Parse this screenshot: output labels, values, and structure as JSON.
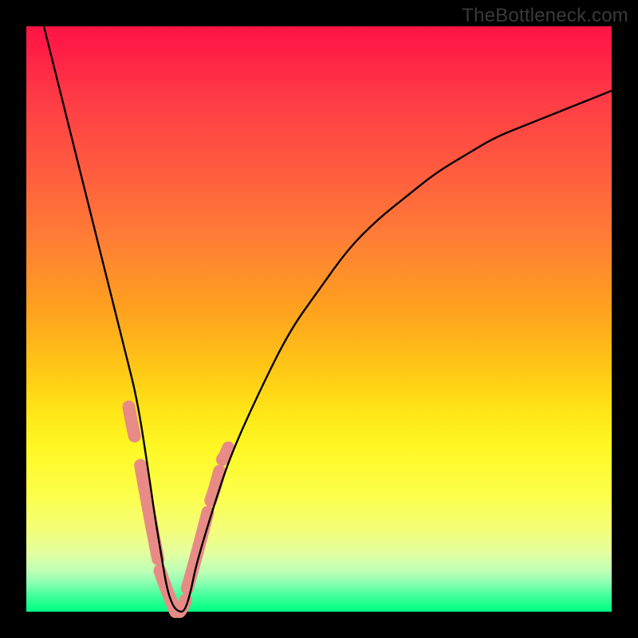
{
  "watermark": "TheBottleneck.com",
  "chart_data": {
    "type": "line",
    "title": "",
    "xlabel": "",
    "ylabel": "",
    "xlim": [
      0,
      100
    ],
    "ylim": [
      0,
      100
    ],
    "grid": false,
    "series": [
      {
        "name": "curve",
        "color": "#000000",
        "x": [
          3,
          5,
          7,
          9,
          11,
          13,
          15,
          17,
          19,
          21,
          22,
          23,
          24,
          25,
          26,
          27,
          28,
          29,
          32,
          35,
          40,
          45,
          50,
          55,
          60,
          65,
          70,
          75,
          80,
          85,
          90,
          95,
          100
        ],
        "y": [
          100,
          92,
          84,
          76,
          68,
          60,
          52,
          44,
          36,
          23,
          16,
          10,
          4,
          1,
          0,
          0,
          3,
          8,
          18,
          27,
          38,
          48,
          55,
          62,
          67,
          71,
          75,
          78,
          81,
          83,
          85,
          87,
          89
        ]
      },
      {
        "name": "marker-band",
        "color": "#e88b86",
        "segments": [
          {
            "x": [
              17.5,
              18.5
            ],
            "y": [
              35,
              30
            ]
          },
          {
            "x": [
              19.5,
              22.5
            ],
            "y": [
              25,
              9
            ]
          },
          {
            "x": [
              22.8,
              25.5
            ],
            "y": [
              7,
              0
            ]
          },
          {
            "x": [
              26.2,
              27.2
            ],
            "y": [
              0,
              2
            ]
          },
          {
            "x": [
              27.5,
              31.0
            ],
            "y": [
              4,
              17
            ]
          },
          {
            "x": [
              31.5,
              33.0
            ],
            "y": [
              19,
              24
            ]
          },
          {
            "x": [
              33.5,
              34.5
            ],
            "y": [
              26,
              28
            ]
          }
        ]
      }
    ],
    "gradient_stops": [
      {
        "pos": 0,
        "color": "#ff1444"
      },
      {
        "pos": 50,
        "color": "#ffb018"
      },
      {
        "pos": 80,
        "color": "#fcff4a"
      },
      {
        "pos": 100,
        "color": "#00ff86"
      }
    ]
  }
}
